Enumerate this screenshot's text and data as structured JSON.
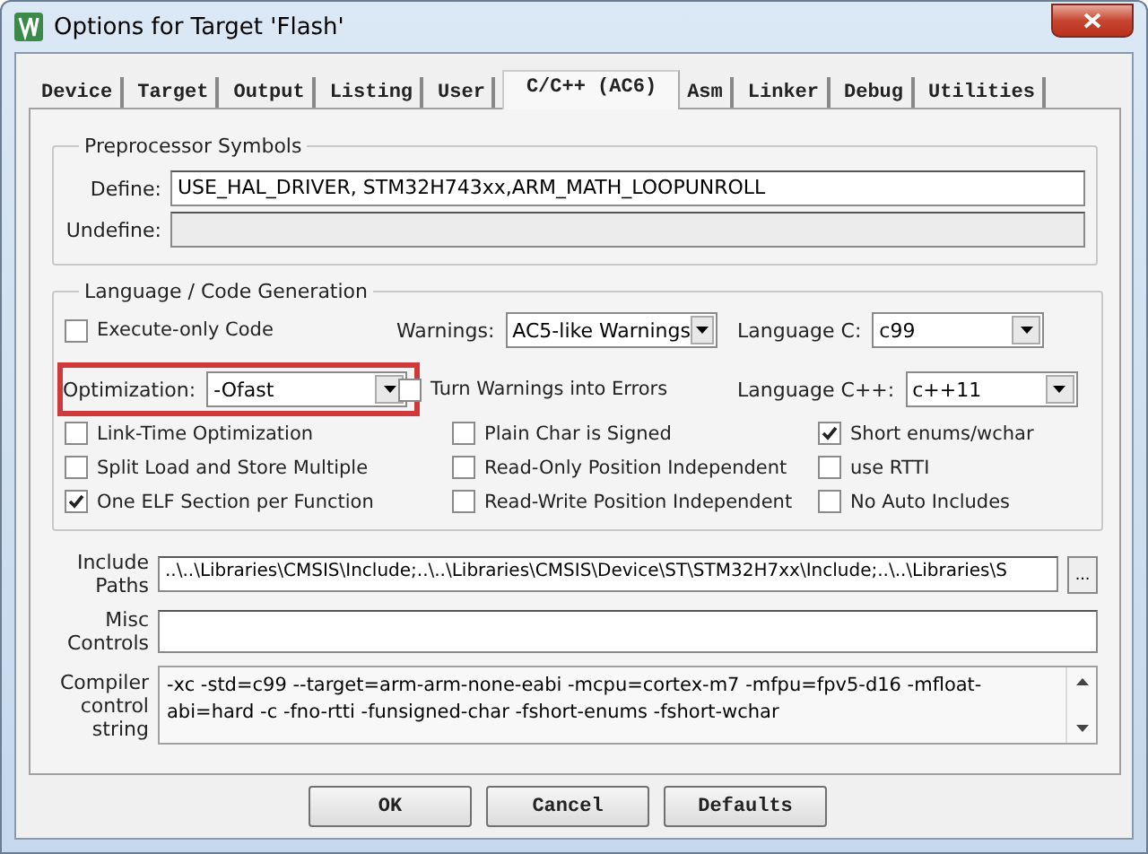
{
  "window": {
    "title": "Options for Target 'Flash'"
  },
  "tabs": [
    {
      "label": "Device",
      "selected": false
    },
    {
      "label": "Target",
      "selected": false
    },
    {
      "label": "Output",
      "selected": false
    },
    {
      "label": "Listing",
      "selected": false
    },
    {
      "label": "User",
      "selected": false
    },
    {
      "label": "C/C++ (AC6)",
      "selected": true
    },
    {
      "label": "Asm",
      "selected": false
    },
    {
      "label": "Linker",
      "selected": false
    },
    {
      "label": "Debug",
      "selected": false
    },
    {
      "label": "Utilities",
      "selected": false
    }
  ],
  "preprocessor": {
    "title": "Preprocessor Symbols",
    "fields": [
      {
        "label": "Define:",
        "value": "USE_HAL_DRIVER, STM32H743xx,ARM_MATH_LOOPUNROLL",
        "disabled": false
      },
      {
        "label": "Undefine:",
        "disabled": true
      }
    ]
  },
  "language": {
    "title": "Language / Code Generation",
    "rows": [
      [
        {
          "kind": "checkbox",
          "label": "Execute-only Code",
          "checked": false
        },
        {
          "kind": "select",
          "label": "Warnings:",
          "value": "AC5-like Warnings",
          "highlighted": false
        },
        {
          "kind": "select",
          "label": "Language C:",
          "value": "c99",
          "highlighted": false
        }
      ],
      [
        {
          "kind": "select",
          "label": "Optimization:",
          "value": "-Ofast",
          "highlighted": true
        },
        {
          "kind": "checkbox",
          "label": "Turn Warnings into Errors",
          "checked": false
        },
        {
          "kind": "select",
          "label": "Language C++:",
          "value": "c++11",
          "highlighted": false
        }
      ],
      [
        {
          "kind": "checkbox",
          "label": "Link-Time Optimization",
          "checked": false
        },
        {
          "kind": "checkbox",
          "label": "Plain Char is Signed",
          "checked": false
        },
        {
          "kind": "checkbox",
          "label": "Short enums/wchar",
          "checked": true
        }
      ],
      [
        {
          "kind": "checkbox",
          "label": "Split Load and Store Multiple",
          "checked": false
        },
        {
          "kind": "checkbox",
          "label": "Read-Only Position Independent",
          "checked": false
        },
        {
          "kind": "checkbox",
          "label": "use RTTI",
          "checked": false
        }
      ],
      [
        {
          "kind": "checkbox",
          "label": "One ELF Section per Function",
          "checked": true
        },
        {
          "kind": "checkbox",
          "label": "Read-Write Position Independent",
          "checked": false
        },
        {
          "kind": "checkbox",
          "label": "No Auto Includes",
          "checked": false
        }
      ]
    ]
  },
  "include_paths": {
    "label": "Include Paths",
    "value": "..\\..\\Libraries\\CMSIS\\Include;..\\..\\Libraries\\CMSIS\\Device\\ST\\STM32H7xx\\Include;..\\..\\Libraries\\S",
    "browse": "..."
  },
  "misc_controls": {
    "label": "Misc Controls"
  },
  "compiler_string": {
    "label": "Compiler control string",
    "value": "-xc -std=c99 --target=arm-arm-none-eabi -mcpu=cortex-m7 -mfpu=fpv5-d16 -mfloat-abi=hard -c -fno-rtti -funsigned-char -fshort-enums -fshort-wchar"
  },
  "buttons": [
    "OK",
    "Cancel",
    "Defaults"
  ]
}
